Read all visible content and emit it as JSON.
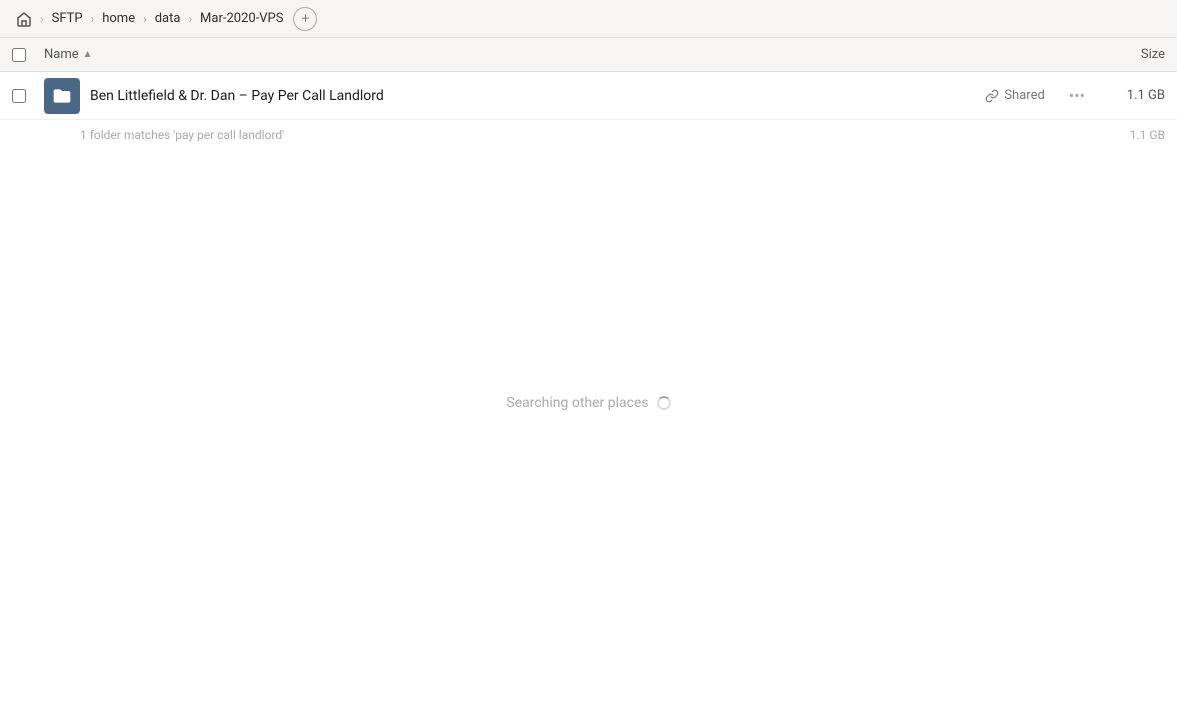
{
  "breadcrumb": {
    "home_icon": "home",
    "items": [
      {
        "label": "SFTP",
        "id": "sftp"
      },
      {
        "label": "home",
        "id": "home"
      },
      {
        "label": "data",
        "id": "data"
      },
      {
        "label": "Mar-2020-VPS",
        "id": "mar-2020-vps"
      }
    ],
    "add_button_label": "+"
  },
  "columns": {
    "name_label": "Name",
    "sort_arrow": "▲",
    "size_label": "Size"
  },
  "file_row": {
    "file_name": "Ben Littlefield & Dr. Dan – Pay Per Call Landlord",
    "shared_label": "Shared",
    "more_icon": "•••",
    "file_size": "1.1 GB"
  },
  "match_info": {
    "text": "1 folder matches 'pay per call landlord'",
    "size": "1.1 GB"
  },
  "searching": {
    "text": "Searching other places"
  }
}
